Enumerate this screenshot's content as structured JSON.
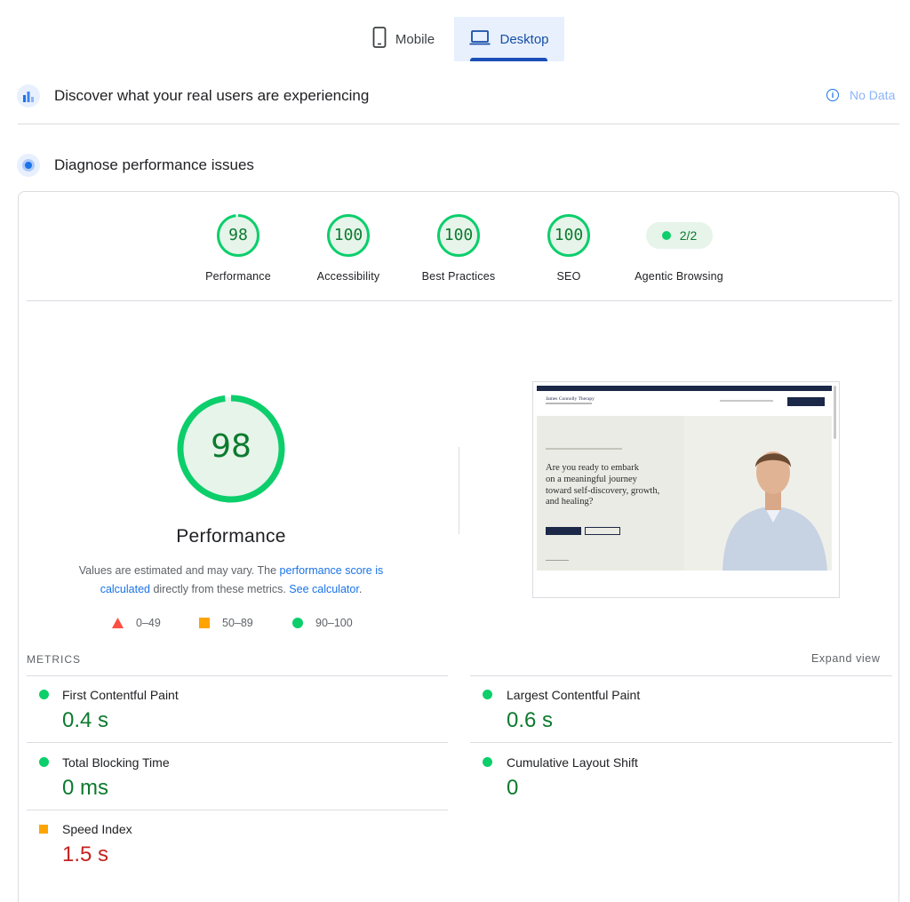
{
  "tabs": [
    {
      "label": "Mobile",
      "icon": "phone-icon"
    },
    {
      "label": "Desktop",
      "icon": "laptop-icon",
      "selected": true
    }
  ],
  "crux": {
    "title": "Discover what your real users are experiencing",
    "status": "No Data"
  },
  "diagnose": {
    "title": "Diagnose performance issues"
  },
  "categories": [
    {
      "score": "98",
      "label": "Performance"
    },
    {
      "score": "100",
      "label": "Accessibility"
    },
    {
      "score": "100",
      "label": "Best Practices"
    },
    {
      "score": "100",
      "label": "SEO"
    }
  ],
  "agentic": {
    "value": "2/2",
    "label": "Agentic Browsing"
  },
  "performance": {
    "score": "98",
    "title": "Performance",
    "desc_1": "Values are estimated and may vary. The ",
    "link_1": "performance score is calculated",
    "desc_2": " directly from these metrics. ",
    "link_2": "See calculator",
    "desc_3": "."
  },
  "legend": {
    "fail": "0–49",
    "average": "50–89",
    "pass": "90–100"
  },
  "screenshot": {
    "site_name": "James Connolly Therapy",
    "headline_1": "Are you ready to embark",
    "headline_2": "on a meaningful journey",
    "headline_3": "toward self-discovery, growth,",
    "headline_4": "and healing?"
  },
  "metrics": {
    "heading": "METRICS",
    "expand": "Expand view",
    "fcp": {
      "label": "First Contentful Paint",
      "value": "0.4 s"
    },
    "lcp": {
      "label": "Largest Contentful Paint",
      "value": "0.6 s"
    },
    "tbt": {
      "label": "Total Blocking Time",
      "value": "0 ms"
    },
    "cls": {
      "label": "Cumulative Layout Shift",
      "value": "0"
    },
    "si": {
      "label": "Speed Index",
      "value": "1.5 s"
    }
  },
  "colors": {
    "pass": "#0cce6b",
    "average": "#ffa400",
    "fail": "#ff4e42",
    "pass_text": "#0c7a2e",
    "fail_text": "#c5221f",
    "accent": "#1a73e8"
  }
}
